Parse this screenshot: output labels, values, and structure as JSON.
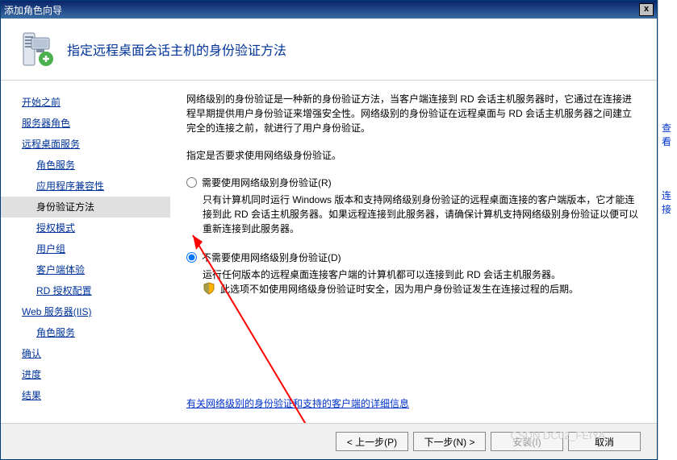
{
  "titlebar": {
    "title": "添加角色向导",
    "close": "x"
  },
  "header": {
    "title": "指定远程桌面会话主机的身份验证方法"
  },
  "sidebar": {
    "items": [
      {
        "label": "开始之前",
        "level": 0
      },
      {
        "label": "服务器角色",
        "level": 0
      },
      {
        "label": "远程桌面服务",
        "level": 0
      },
      {
        "label": "角色服务",
        "level": 1
      },
      {
        "label": "应用程序兼容性",
        "level": 1
      },
      {
        "label": "身份验证方法",
        "level": 1,
        "selected": true
      },
      {
        "label": "授权模式",
        "level": 1
      },
      {
        "label": "用户组",
        "level": 1
      },
      {
        "label": "客户端体验",
        "level": 1
      },
      {
        "label": "RD 授权配置",
        "level": 1
      },
      {
        "label": "Web 服务器(IIS)",
        "level": 0
      },
      {
        "label": "角色服务",
        "level": 1
      },
      {
        "label": "确认",
        "level": 0
      },
      {
        "label": "进度",
        "level": 0
      },
      {
        "label": "结果",
        "level": 0
      }
    ]
  },
  "content": {
    "intro": "网络级别的身份验证是一种新的身份验证方法，当客户端连接到 RD 会话主机服务器时，它通过在连接进程早期提供用户身份验证来增强安全性。网络级别的身份验证在远程桌面与 RD 会话主机服务器之间建立完全的连接之前，就进行了用户身份验证。",
    "prompt": "指定是否要求使用网络级身份验证。",
    "opt1": {
      "label": "需要使用网络级别身份验证(R)",
      "desc": "只有计算机同时运行 Windows 版本和支持网络级别身份验证的远程桌面连接的客户端版本，它才能连接到此 RD 会话主机服务器。如果远程连接到此服务器，请确保计算机支持网络级别身份验证以便可以重新连接到此服务器。"
    },
    "opt2": {
      "label": "不需要使用网络级别身份验证(D)",
      "desc": "运行任何版本的远程桌面连接客户端的计算机都可以连接到此 RD 会话主机服务器。",
      "warn": "此选项不如使用网络级身份验证时安全，因为用户身份验证发生在连接过程的后期。"
    },
    "link": "有关网络级别的身份验证和支持的客户端的详细信息"
  },
  "footer": {
    "prev": "< 上一步(P)",
    "next": "下一步(N) >",
    "install": "安装(I)",
    "cancel": "取消"
  },
  "rightstrip": {
    "a": "查看",
    "b": "连接"
  },
  "watermark": "CSDN    DC02_FEIYA"
}
